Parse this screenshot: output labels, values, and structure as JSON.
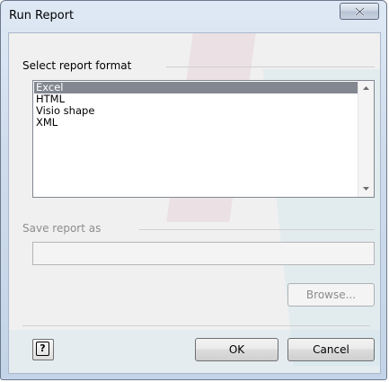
{
  "window": {
    "title": "Run Report"
  },
  "format_group": {
    "label": "Select report format",
    "items": [
      {
        "label": "Excel",
        "selected": true
      },
      {
        "label": "HTML",
        "selected": false
      },
      {
        "label": "Visio shape",
        "selected": false
      },
      {
        "label": "XML",
        "selected": false
      }
    ]
  },
  "save_group": {
    "label": "Save report as",
    "value": "",
    "enabled": false
  },
  "buttons": {
    "browse": "Browse...",
    "ok": "OK",
    "cancel": "Cancel",
    "help_glyph": "?"
  },
  "icons": {
    "close": "close-icon",
    "help": "help-icon",
    "scroll_up": "scroll-up-arrow-icon",
    "scroll_down": "scroll-down-arrow-icon"
  },
  "colors": {
    "selection": "#828790",
    "title_bar": "#cfdcec",
    "disabled_text": "#8d8d8d"
  }
}
